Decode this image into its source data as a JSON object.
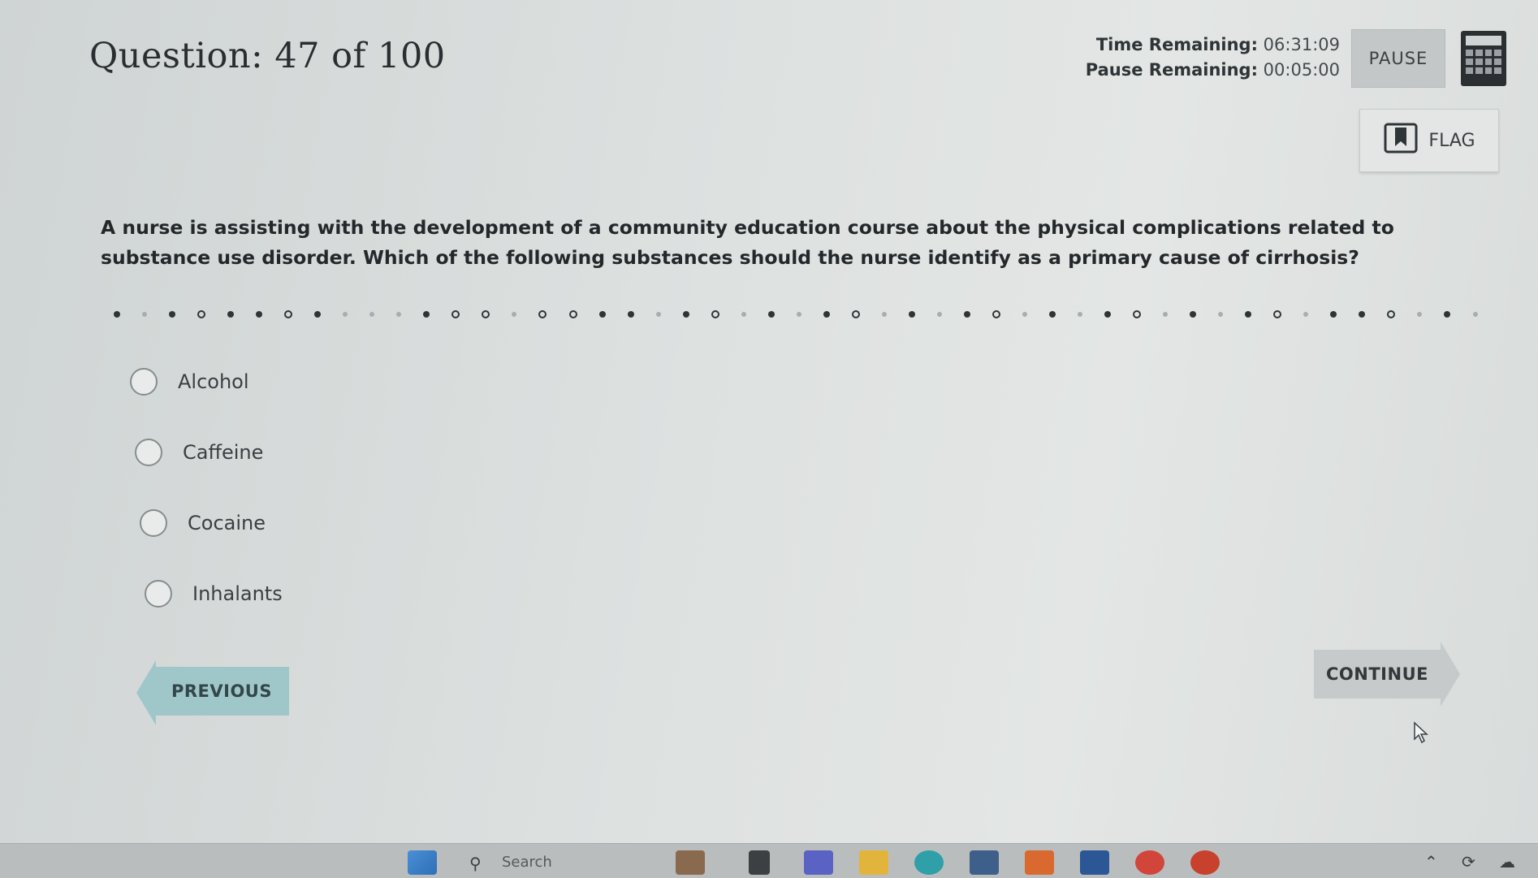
{
  "header": {
    "question_label": "Question: 47 of 100"
  },
  "timers": {
    "time_label": "Time Remaining:",
    "time_value": "06:31:09",
    "pause_label": "Pause Remaining:",
    "pause_value": "00:05:00"
  },
  "toolbar": {
    "pause_label": "PAUSE",
    "flag_label": "FLAG",
    "calculator_icon": "calculator-icon",
    "flag_icon": "bookmark-icon"
  },
  "question": {
    "text": "A nurse is assisting with the development of a community education course about the physical complications related to substance use disorder. Which of the following substances should the nurse identify as a primary cause of cirrhosis?"
  },
  "options": [
    {
      "label": "Alcohol"
    },
    {
      "label": "Caffeine"
    },
    {
      "label": "Cocaine"
    },
    {
      "label": "Inhalants"
    }
  ],
  "navigation": {
    "previous_label": "PREVIOUS",
    "continue_label": "CONTINUE"
  },
  "taskbar": {
    "search_placeholder": "Search"
  },
  "colors": {
    "previous_button": "#9fc7ca",
    "continue_button": "#c6cacb",
    "background": "#dde1e0"
  }
}
